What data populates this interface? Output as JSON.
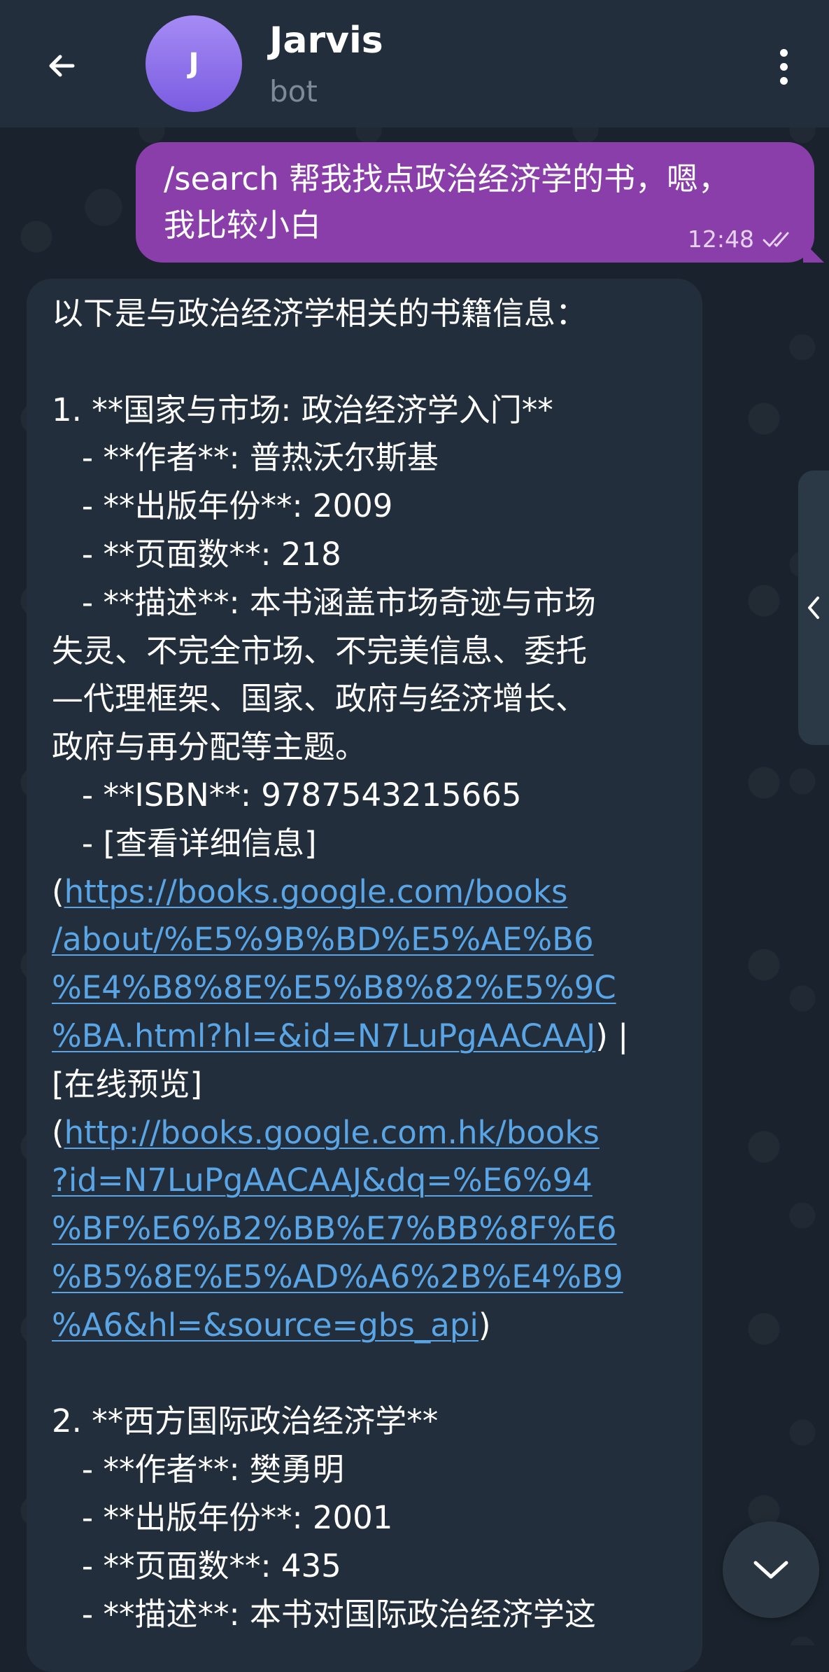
{
  "header": {
    "back_icon": "arrow-left-icon",
    "avatar_letter": "J",
    "title": "Jarvis",
    "subtitle": "bot",
    "menu_icon": "more-vertical-icon"
  },
  "messages": {
    "outgoing": {
      "text": "/search 帮我找点政治经济学的书，嗯，\n我比较小白",
      "time": "12:48",
      "status_icon": "double-check-icon"
    },
    "incoming": {
      "lines": [
        {
          "text": "以下是与政治经济学相关的书籍信息："
        },
        {
          "text": ""
        },
        {
          "text": "1. **国家与市场: 政治经济学入门**"
        },
        {
          "text": "   - **作者**: 普热沃尔斯基"
        },
        {
          "text": "   - **出版年份**: 2009"
        },
        {
          "text": "   - **页面数**: 218"
        },
        {
          "text": "   - **描述**: 本书涵盖市场奇迹与市场"
        },
        {
          "text": "失灵、不完全市场、不完美信息、委托"
        },
        {
          "text": "—代理框架、国家、政府与经济增长、"
        },
        {
          "text": "政府与再分配等主题。"
        },
        {
          "text": "   - **ISBN**: 9787543215665"
        },
        {
          "text": "   - [查看详细信息]"
        },
        {
          "pre": "(",
          "link": "https://books.google.com/books"
        },
        {
          "link": "/about/%E5%9B%BD%E5%AE%B6"
        },
        {
          "link": "%E4%B8%8E%E5%B8%82%E5%9C"
        },
        {
          "link": "%BA.html?hl=&id=N7LuPgAACAAJ",
          "post": ") |"
        },
        {
          "text": "[在线预览]"
        },
        {
          "pre": "(",
          "link": "http://books.google.com.hk/books"
        },
        {
          "link": "?id=N7LuPgAACAAJ&dq=%E6%94"
        },
        {
          "link": "%BF%E6%B2%BB%E7%BB%8F%E6"
        },
        {
          "link": "%B5%8E%E5%AD%A6%2B%E4%B9"
        },
        {
          "link": "%A6&hl=&source=gbs_api",
          "post": ")"
        },
        {
          "text": ""
        },
        {
          "text": "2. **西方国际政治经济学**"
        },
        {
          "text": "   - **作者**: 樊勇明"
        },
        {
          "text": "   - **出版年份**: 2001"
        },
        {
          "text": "   - **页面数**: 435"
        },
        {
          "text": "   - **描述**: 本书对国际政治经济学这"
        }
      ]
    }
  },
  "side_panel": {
    "icon": "chevron-left-icon"
  },
  "scroll_button": {
    "icon": "chevron-down-icon"
  },
  "colors": {
    "header_bg": "#232e3c",
    "outgoing_bubble": "#8a3ea9",
    "incoming_bubble": "#222e3b",
    "link": "#5aa5e6",
    "subtitle": "#7d8b99"
  }
}
